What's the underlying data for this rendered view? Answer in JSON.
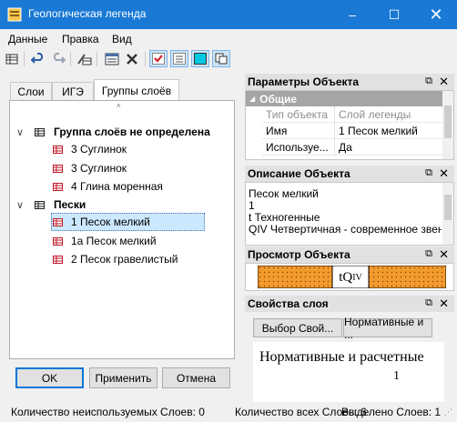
{
  "window": {
    "title": "Геологическая легенда"
  },
  "menu": [
    "Данные",
    "Правка",
    "Вид"
  ],
  "toolbar": {
    "icons": [
      "grid-icon",
      "undo-icon",
      "redo-icon",
      "edit-layer-icon",
      "table-icon",
      "delete-icon",
      "check-icon",
      "notes-icon",
      "color-fill-icon",
      "copy-icon"
    ]
  },
  "tabs": [
    "Слои",
    "ИГЭ",
    "Группы слоёв"
  ],
  "tree": {
    "groups": [
      {
        "label": "Группа слоёв не определена",
        "items": [
          "3 Суглинок",
          "3 Суглинок",
          "4 Глина моренная"
        ]
      },
      {
        "label": "Пески",
        "items": [
          "1 Песок мелкий",
          "1а Песок мелкий",
          "2 Песок гравелистый"
        ]
      }
    ],
    "selected": "1 Песок мелкий"
  },
  "buttons": {
    "ok": "OK",
    "apply": "Применить",
    "cancel": "Отмена"
  },
  "params_panel": {
    "title": "Параметры Объекта",
    "category": "Общие",
    "rows": [
      {
        "name": "Тип объекта",
        "value": "Слой легенды"
      },
      {
        "name": "Имя",
        "value": "1 Песок мелкий"
      },
      {
        "name": "Используе...",
        "value": "Да"
      }
    ]
  },
  "desc_panel": {
    "title": "Описание Объекта",
    "lines": [
      "Песок мелкий",
      "1",
      "t Техногенные",
      "QIV Четвертичная - современное звено"
    ]
  },
  "preview_panel": {
    "title": "Просмотр Объекта",
    "code": "tQ",
    "sub": "IV",
    "fill": "#f39a2e"
  },
  "props_panel": {
    "title": "Свойства слоя",
    "tabs": [
      "Выбор Свой...",
      "Нормативные и ..."
    ],
    "content": "Нормативные и расчетные",
    "content_digit": "1"
  },
  "status": {
    "unused": "Количество неиспользуемых Слоев: 0",
    "total": "Количество всех Слоев: 6",
    "selected": "Выделено Слоев: 1"
  },
  "colors": {
    "accent": "#1979d5",
    "layer_icon": "#c0182a",
    "selection": "#cce8ff"
  }
}
